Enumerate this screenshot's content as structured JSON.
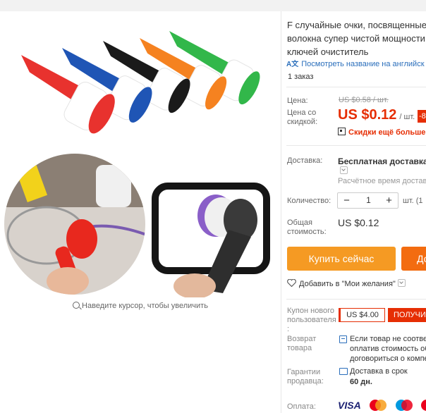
{
  "gallery": {
    "zoom_hint": "Наведите курсор, чтобы увеличить"
  },
  "product": {
    "title_lines": [
      "F случайные очки, посвященные",
      "волокна супер чистой мощности",
      "ключей очиститель"
    ],
    "translate_link": "Посмотреть название на английск",
    "orders": "1 заказ"
  },
  "pricing": {
    "price_label": "Цена:",
    "old_price": "US $0.58 / шт.",
    "discount_label_lines": [
      "Цена со",
      "скидкой:"
    ],
    "new_price": "US $0.12",
    "unit": "/ шт.",
    "discount_badge": "-8",
    "promo_text": "Скидки ещё больше в"
  },
  "shipping": {
    "label": "Доставка:",
    "value": "Бесплатная доставка в",
    "time": "Расчётное время доставк"
  },
  "quantity": {
    "label": "Количество:",
    "value": "1",
    "minus": "−",
    "plus": "+",
    "unit": "шт. (1"
  },
  "total": {
    "label_lines": [
      "Общая",
      "стоимость:"
    ],
    "value": "US $0.12"
  },
  "actions": {
    "buy_now": "Купить сейчас",
    "add_to_cart": "До",
    "wishlist": "Добавить в \"Мои желания\""
  },
  "coupon": {
    "label_lines": [
      "Купон нового",
      "пользователя",
      ":"
    ],
    "amount": "US $4.00",
    "get": "ПОЛУЧИ"
  },
  "returns": {
    "label_lines": [
      "Возврат",
      "товара"
    ],
    "text_lines": [
      "Если товар не соответ",
      "оплатив стоимость об",
      "договориться о компе"
    ]
  },
  "guarantee": {
    "label_lines": [
      "Гарантии",
      "продавца:"
    ],
    "text": "Доставка в срок",
    "days": "60 дн."
  },
  "payment": {
    "label": "Оплата:",
    "methods": [
      "VISA",
      "MasterCard",
      "Maestro",
      "MasterCard"
    ]
  },
  "colors": {
    "accent_red": "#e62e04",
    "buy_orange": "#f59a23",
    "cart_orange": "#f36c10",
    "link_blue": "#2a6ebb"
  }
}
